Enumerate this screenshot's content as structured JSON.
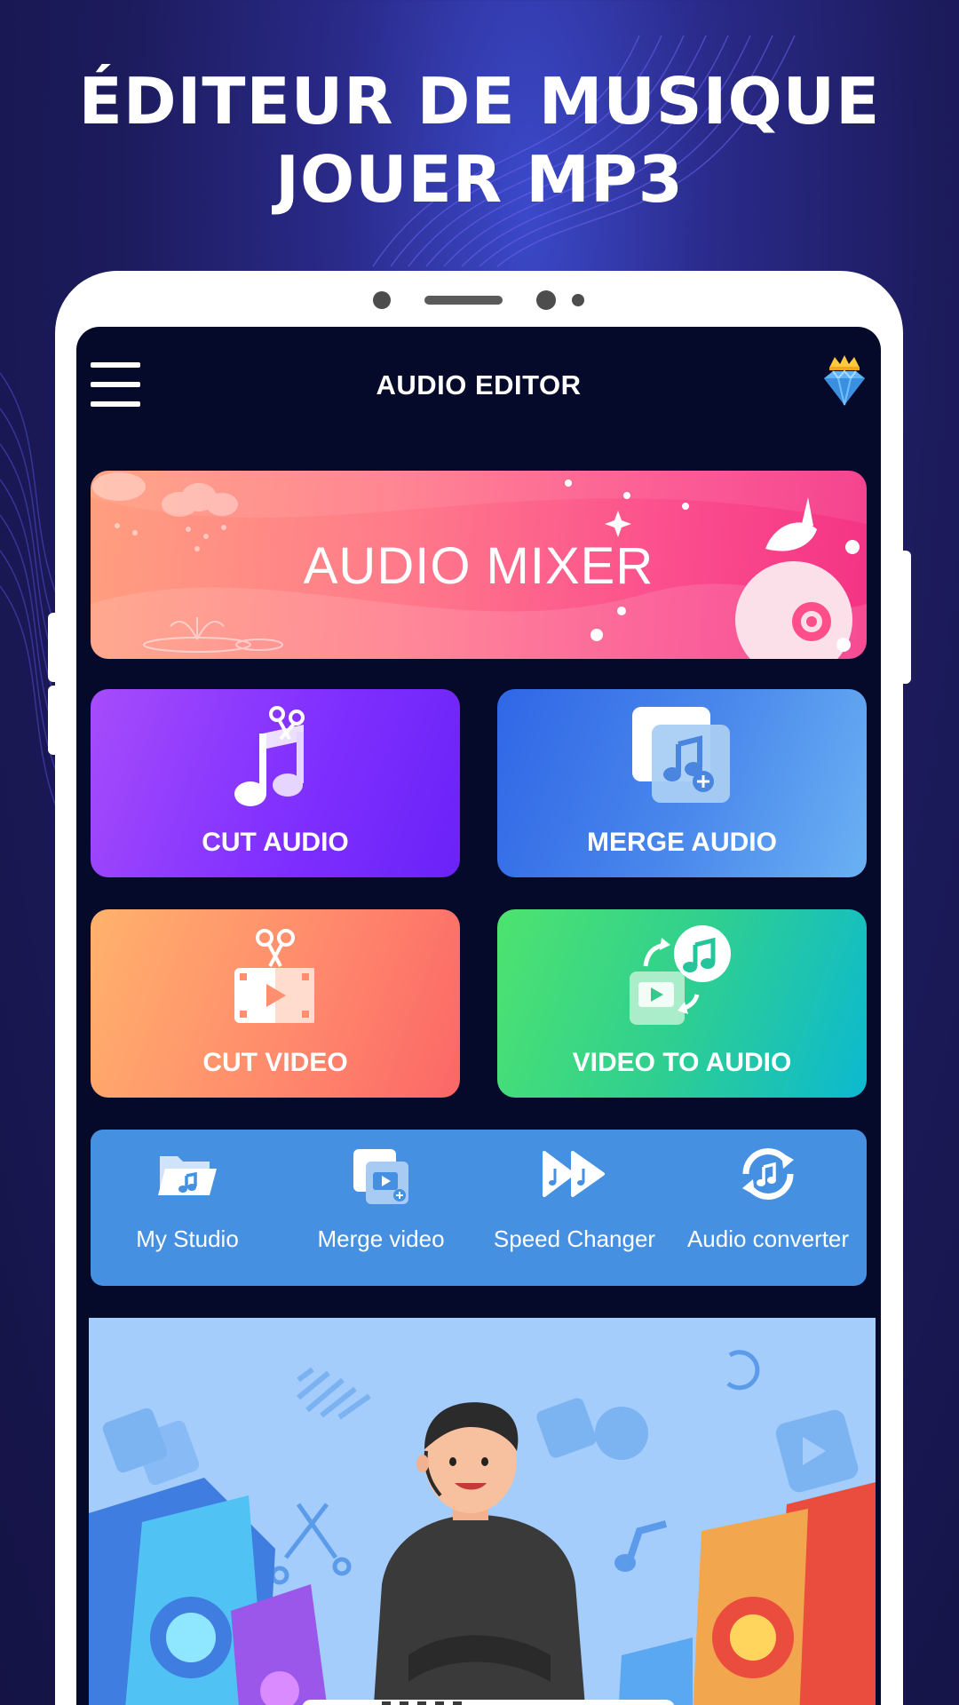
{
  "promo": {
    "headline_line1": "ÉDITEUR DE MUSIQUE",
    "headline_line2": "JOUER MP3"
  },
  "appbar": {
    "title": "AUDIO EDITOR",
    "menu_icon": "hamburger-menu-icon",
    "premium_icon": "diamond-crown-icon"
  },
  "banner": {
    "title": "AUDIO MIXER"
  },
  "tiles": [
    {
      "label": "CUT AUDIO",
      "icon": "music-scissors-icon"
    },
    {
      "label": "MERGE AUDIO",
      "icon": "merge-music-icon"
    },
    {
      "label": "CUT VIDEO",
      "icon": "film-scissors-icon"
    },
    {
      "label": "VIDEO TO AUDIO",
      "icon": "video-to-music-icon"
    }
  ],
  "tools": [
    {
      "label": "My Studio",
      "icon": "folder-music-icon"
    },
    {
      "label": "Merge video",
      "icon": "merge-video-icon"
    },
    {
      "label": "Speed Changer",
      "icon": "fast-forward-icon"
    },
    {
      "label": "Audio converter",
      "icon": "convert-music-icon"
    }
  ],
  "colors": {
    "screen_bg": "#050a2b",
    "tools_bg": "#4590e0",
    "illustration_bg": "#a4cdfb"
  }
}
